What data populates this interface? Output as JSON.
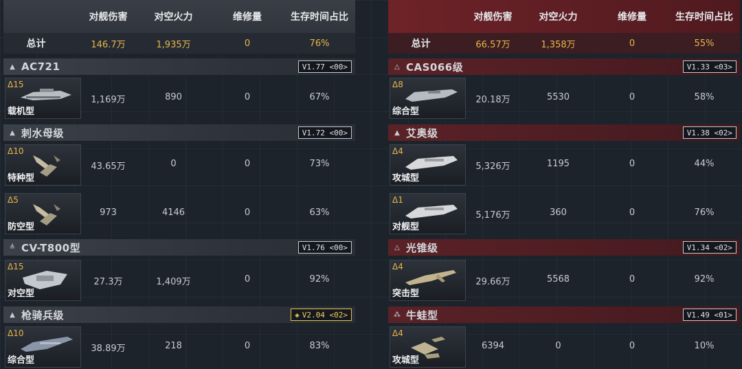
{
  "columns": {
    "damage": "对舰伤害",
    "antiair": "对空火力",
    "repair": "维修量",
    "survival": "生存时间占比"
  },
  "left": {
    "totals": {
      "label": "总计",
      "damage": "146.7万",
      "antiair": "1,935万",
      "repair": "0",
      "survival": "76%"
    },
    "groups": [
      {
        "name": "AC721",
        "version": "V1.77 <00>",
        "ships": [
          {
            "level": "Δ15",
            "type": "载机型",
            "damage": "1,169万",
            "antiair": "890",
            "repair": "0",
            "survival": "67%"
          }
        ]
      },
      {
        "name": "刺水母级",
        "version": "V1.72 <00>",
        "ships": [
          {
            "level": "Δ10",
            "type": "特种型",
            "damage": "43.65万",
            "antiair": "0",
            "repair": "0",
            "survival": "73%"
          },
          {
            "level": "Δ5",
            "type": "防空型",
            "damage": "973",
            "antiair": "4146",
            "repair": "0",
            "survival": "63%"
          }
        ]
      },
      {
        "name": "CV-T800型",
        "version": "V1.76 <00>",
        "ships": [
          {
            "level": "Δ15",
            "type": "对空型",
            "damage": "27.3万",
            "antiair": "1,409万",
            "repair": "0",
            "survival": "92%"
          }
        ]
      },
      {
        "name": "枪骑兵级",
        "version": "V2.04 <02>",
        "version_gold": true,
        "ships": [
          {
            "level": "Δ10",
            "type": "综合型",
            "damage": "38.89万",
            "antiair": "218",
            "repair": "0",
            "survival": "83%"
          }
        ]
      }
    ]
  },
  "right": {
    "totals": {
      "label": "总计",
      "damage": "66.57万",
      "antiair": "1,358万",
      "repair": "0",
      "survival": "55%"
    },
    "groups": [
      {
        "name": "CAS066级",
        "version": "V1.33 <03>",
        "ships": [
          {
            "level": "Δ8",
            "type": "综合型",
            "damage": "20.18万",
            "antiair": "5530",
            "repair": "0",
            "survival": "58%"
          }
        ]
      },
      {
        "name": "艾奥级",
        "version": "V1.38 <02>",
        "ships": [
          {
            "level": "Δ4",
            "type": "攻城型",
            "damage": "5,326万",
            "antiair": "1195",
            "repair": "0",
            "survival": "44%"
          },
          {
            "level": "Δ1",
            "type": "对舰型",
            "damage": "5,176万",
            "antiair": "360",
            "repair": "0",
            "survival": "76%"
          }
        ]
      },
      {
        "name": "光锥级",
        "version": "V1.34 <02>",
        "ships": [
          {
            "level": "Δ4",
            "type": "突击型",
            "damage": "29.66万",
            "antiair": "5568",
            "repair": "0",
            "survival": "92%"
          }
        ]
      },
      {
        "name": "牛蛙型",
        "version": "V1.49 <01>",
        "ships": [
          {
            "level": "Δ4",
            "type": "攻城型",
            "damage": "6394",
            "antiair": "0",
            "repair": "0",
            "survival": "10%"
          }
        ]
      }
    ]
  },
  "colors": {
    "accent_gold": "#e8b84a",
    "enemy_red": "#6e2328"
  }
}
